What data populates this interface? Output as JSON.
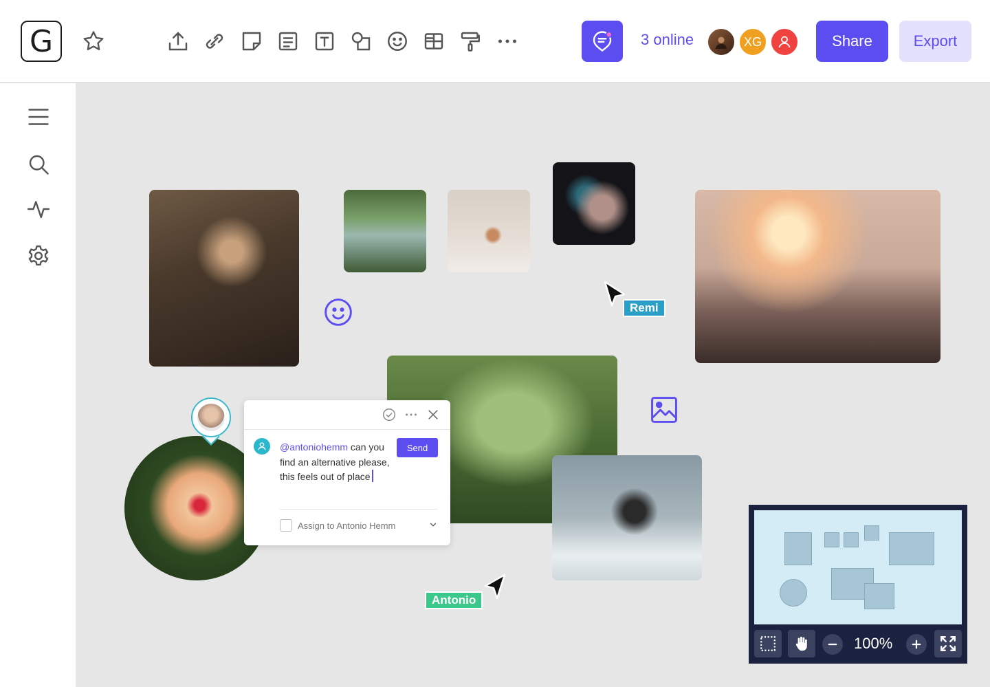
{
  "header": {
    "logo_letter": "G",
    "online_text": "3 online",
    "avatars": [
      {
        "kind": "photo",
        "initials": ""
      },
      {
        "kind": "initials",
        "initials": "XG"
      },
      {
        "kind": "user-icon",
        "initials": ""
      }
    ],
    "share_label": "Share",
    "export_label": "Export",
    "toolbar_icons": [
      "upload-icon",
      "link-icon",
      "sticky-note-icon",
      "card-icon",
      "text-icon",
      "shapes-icon",
      "emoji-icon",
      "table-icon",
      "paint-roller-icon",
      "more-icon"
    ]
  },
  "sidebar": {
    "icons": [
      "menu-icon",
      "search-icon",
      "activity-icon",
      "settings-icon"
    ]
  },
  "canvas": {
    "cursors": [
      {
        "name": "Remi",
        "color": "#2c9fc8"
      },
      {
        "name": "Antonio",
        "color": "#3cc88a"
      }
    ]
  },
  "comment": {
    "mention": "@antoniohemm",
    "text_after_mention": " can you find an alternative please, this feels out of place",
    "send_label": "Send",
    "assign_label": "Assign to Antonio Hemm"
  },
  "minimap": {
    "zoom": "100%"
  },
  "colors": {
    "accent": "#5b4df0",
    "accent_light": "#e4e1fc",
    "canvas_bg": "#e6e6e6",
    "minimap_bg": "#1a2240"
  }
}
